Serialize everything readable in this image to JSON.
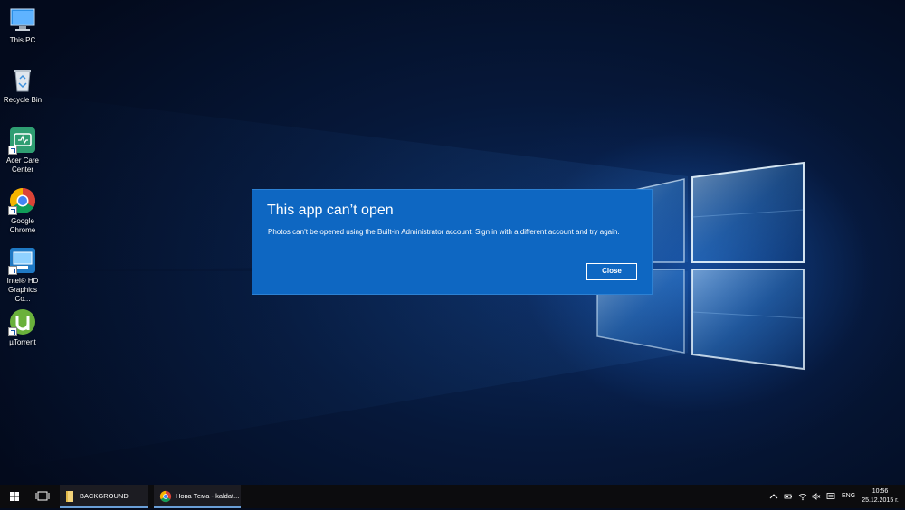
{
  "desktop_icons": [
    {
      "label": "This PC",
      "icon": "this-pc-icon"
    },
    {
      "label": "Recycle Bin",
      "icon": "recycle-bin-icon"
    },
    {
      "label": "Acer Care Center",
      "icon": "acer-care-center-icon"
    },
    {
      "label": "Google Chrome",
      "icon": "chrome-icon"
    },
    {
      "label": "Intel® HD Graphics Co...",
      "icon": "intel-graphics-icon"
    },
    {
      "label": "µTorrent",
      "icon": "utorrent-icon"
    }
  ],
  "dialog": {
    "title": "This app can’t open",
    "message": "Photos can’t be opened using the Built-in Administrator account. Sign in with a different account and try again.",
    "close_label": "Close"
  },
  "taskbar": {
    "apps": [
      {
        "label": "BACKGROUND",
        "icon": "folder-icon"
      },
      {
        "label": "Нова Тема - kaldat...",
        "icon": "chrome-icon"
      }
    ],
    "language": "ENG",
    "time": "10:56",
    "date": "25.12.2015 г."
  },
  "colors": {
    "dialog_bg": "#0e67c2",
    "taskbar_bg": "#0c0c0e",
    "accent": "#6a9fd8"
  }
}
